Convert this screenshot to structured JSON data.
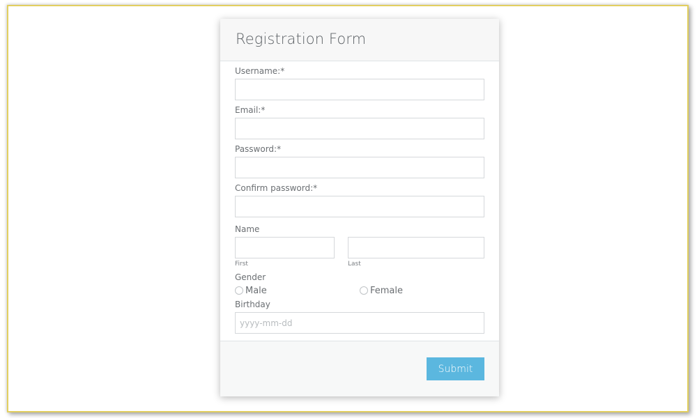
{
  "form": {
    "title": "Registration Form",
    "fields": {
      "username": {
        "label": "Username:*",
        "value": "",
        "placeholder": ""
      },
      "email": {
        "label": "Email:*",
        "value": "",
        "placeholder": ""
      },
      "password": {
        "label": "Password:*",
        "value": "",
        "placeholder": ""
      },
      "confirm_password": {
        "label": "Confirm password:*",
        "value": "",
        "placeholder": ""
      },
      "name": {
        "label": "Name",
        "first": {
          "sublabel": "First",
          "value": ""
        },
        "last": {
          "sublabel": "Last",
          "value": ""
        }
      },
      "gender": {
        "label": "Gender",
        "options": [
          {
            "label": "Male",
            "checked": false
          },
          {
            "label": "Female",
            "checked": false
          }
        ]
      },
      "birthday": {
        "label": "Birthday",
        "value": "",
        "placeholder": "yyyy-mm-dd"
      }
    },
    "submit_label": "Submit"
  },
  "colors": {
    "frame_border": "#e2cf5f",
    "submit_button": "#5bb7df",
    "header_bg": "#f7f7f7",
    "footer_bg": "#f7f8f8"
  }
}
